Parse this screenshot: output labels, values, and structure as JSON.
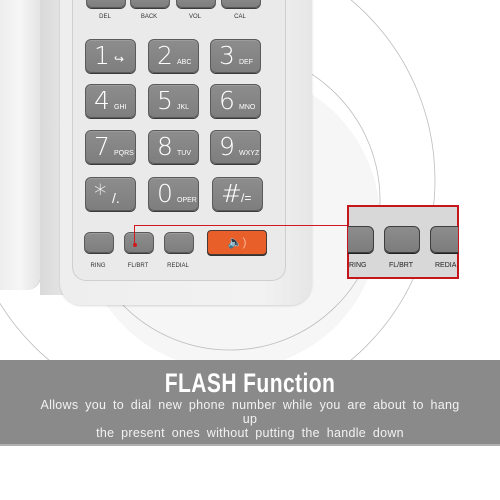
{
  "top_keys": [
    {
      "label": "DEL"
    },
    {
      "label": "BACK"
    },
    {
      "label": "VOL"
    },
    {
      "label": "CAL"
    }
  ],
  "keypad": [
    {
      "digit": "1",
      "sub": "↪"
    },
    {
      "digit": "2",
      "sub": "ABC"
    },
    {
      "digit": "3",
      "sub": "DEF"
    },
    {
      "digit": "4",
      "sub": "GHI"
    },
    {
      "digit": "5",
      "sub": "JKL"
    },
    {
      "digit": "6",
      "sub": "MNO"
    },
    {
      "digit": "7",
      "sub": "PQRS"
    },
    {
      "digit": "8",
      "sub": "TUV"
    },
    {
      "digit": "9",
      "sub": "WXYZ"
    },
    {
      "digit": "*",
      "sub": "/."
    },
    {
      "digit": "0",
      "sub": "OPER"
    },
    {
      "digit": "#",
      "sub": "/="
    }
  ],
  "function_keys": [
    {
      "label": "RING"
    },
    {
      "label": "FL/BRT"
    },
    {
      "label": "REDIAL"
    }
  ],
  "speaker_key": {
    "icon": "speaker-icon",
    "glyph": "🔈)"
  },
  "zoom_callout": {
    "labels": [
      "RING",
      "FL/BRT",
      "REDIA"
    ]
  },
  "banner": {
    "title": "FLASH Function",
    "description_line1": "Allows you to dial new phone number while you are about to hang up",
    "description_line2": "the present ones without putting the handle down"
  },
  "colors": {
    "accent_orange": "#e95f2a",
    "callout_red": "#c4161c",
    "banner_gray": "#8a8a8a",
    "key_gray": "#858585"
  }
}
